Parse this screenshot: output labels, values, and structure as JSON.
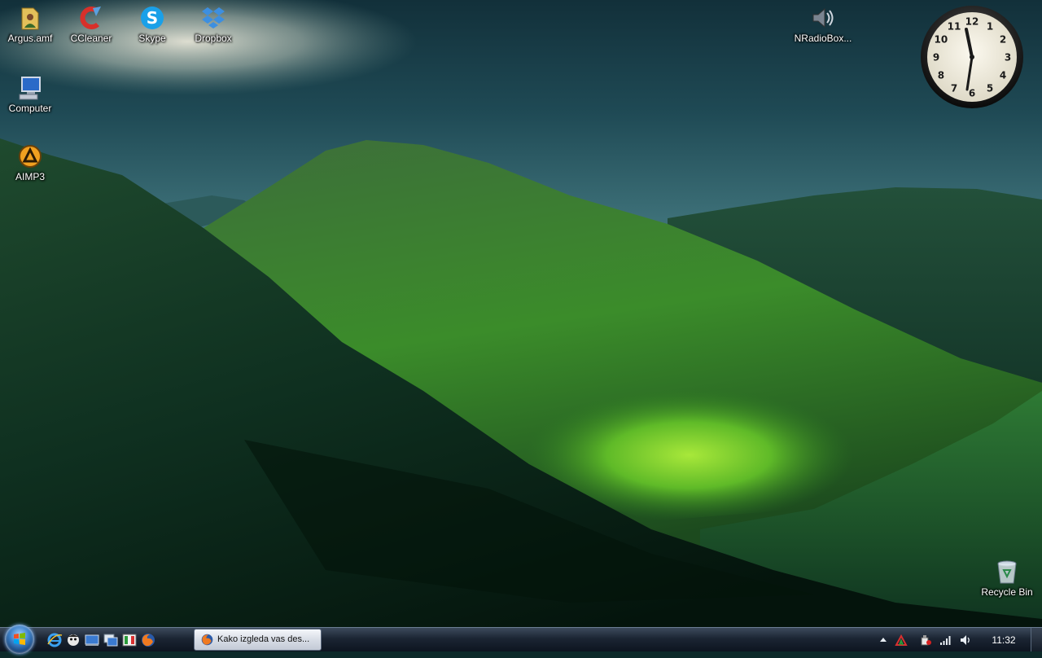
{
  "desktop": {
    "icons": [
      {
        "label": "Argus.amf",
        "icon": "folder-user-icon"
      },
      {
        "label": "CCleaner",
        "icon": "ccleaner-icon"
      },
      {
        "label": "Skype",
        "icon": "skype-icon"
      },
      {
        "label": "Dropbox",
        "icon": "dropbox-icon"
      },
      {
        "label": "NRadioBox...",
        "icon": "speaker-icon"
      },
      {
        "label": "Computer",
        "icon": "computer-icon"
      },
      {
        "label": "AIMP3",
        "icon": "aimp-icon"
      },
      {
        "label": "Recycle Bin",
        "icon": "recycle-bin-icon"
      }
    ]
  },
  "clock_gadget": {
    "numbers": [
      "12",
      "1",
      "2",
      "3",
      "4",
      "5",
      "6",
      "7",
      "8",
      "9",
      "10",
      "11"
    ],
    "time": "11:32"
  },
  "taskbar": {
    "quick_launch": [
      "internet-explorer-icon",
      "messenger-icon",
      "show-desktop-icon",
      "switch-windows-icon",
      "media-icon",
      "firefox-icon"
    ],
    "task_button_label": "Kako izgleda vas des...",
    "tray_icons": [
      "show-hidden-icons-icon",
      "tray-app-icon",
      "safely-remove-icon",
      "network-signal-icon",
      "volume-icon"
    ],
    "clock": "11:32"
  },
  "colors": {
    "taskbar": "#1b2533",
    "sky": "#2a5560",
    "hills": "#2f7a2a"
  }
}
